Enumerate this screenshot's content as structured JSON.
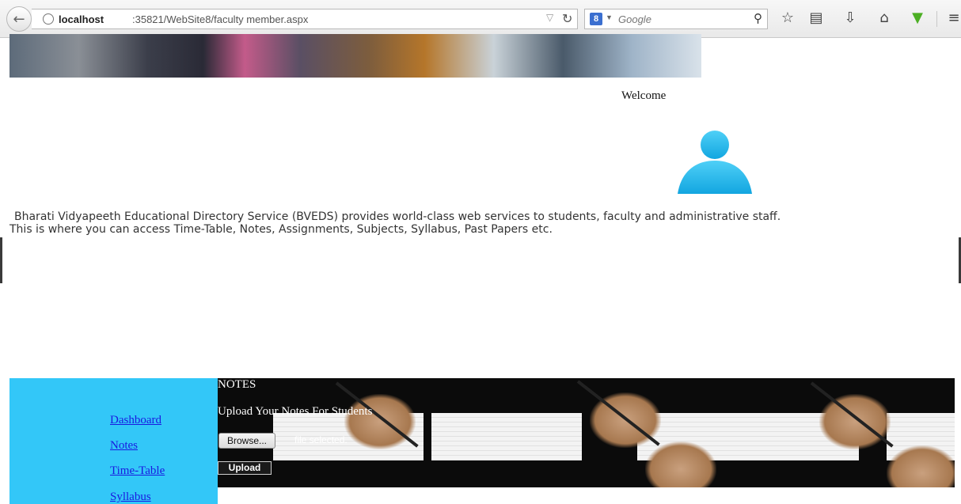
{
  "browser": {
    "url_host": "localhost",
    "url_rest": ":35821/WebSite8/faculty member.aspx",
    "search_engine_glyph": "8",
    "search_placeholder": "Google",
    "icons": [
      "back-arrow-icon",
      "globe-icon",
      "dropdown-icon",
      "reload-icon",
      "search-icon",
      "star-icon",
      "reading-list-icon",
      "download-icon",
      "home-icon",
      "addon-icon",
      "menu-icon"
    ]
  },
  "header": {
    "welcome_text": "Welcome"
  },
  "intro": {
    "line1": "Bharati Vidyapeeth Educational Directory Service (BVEDS) provides world-class web services to students, faculty and administrative staff.",
    "line2": "This is where you can access Time-Table, Notes, Assignments, Subjects, Syllabus, Past Papers etc."
  },
  "sidebar": {
    "items": [
      {
        "label": "Dashboard"
      },
      {
        "label": "Notes"
      },
      {
        "label": "Time-Table"
      },
      {
        "label": "Syllabus"
      }
    ]
  },
  "notes": {
    "title": "NOTES",
    "upload_heading": "Upload Your Notes For Students",
    "browse_label": "Browse...",
    "file_status": "file selected.",
    "upload_label": "Upload"
  },
  "colors": {
    "sidebar_bg": "#33c7f8",
    "link": "#1a1ae0",
    "avatar": "#1fb4ea"
  }
}
